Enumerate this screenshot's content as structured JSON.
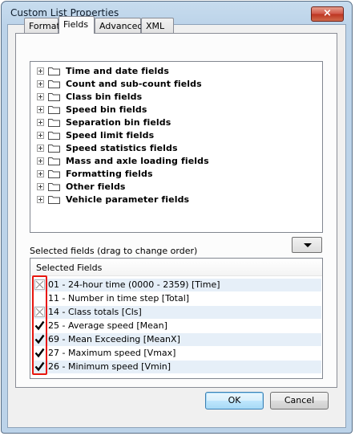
{
  "window": {
    "title": "Custom List Properties",
    "close_glyph": "×"
  },
  "tabs": [
    {
      "label": "Format",
      "active": false
    },
    {
      "label": "Fields",
      "active": true
    },
    {
      "label": "Advanced",
      "active": false
    },
    {
      "label": "XML",
      "active": false
    }
  ],
  "tree": {
    "items": [
      {
        "label": "Time and date fields"
      },
      {
        "label": "Count and sub-count fields"
      },
      {
        "label": "Class bin fields"
      },
      {
        "label": "Speed bin fields"
      },
      {
        "label": "Separation bin fields"
      },
      {
        "label": "Speed limit fields"
      },
      {
        "label": "Speed statistics fields"
      },
      {
        "label": "Mass and axle loading fields"
      },
      {
        "label": "Formatting fields"
      },
      {
        "label": "Other fields"
      },
      {
        "label": "Vehicle parameter fields"
      }
    ]
  },
  "selected": {
    "label": "Selected fields (drag to change order)",
    "header": "Selected Fields",
    "rows": [
      {
        "text": "01 - 24-hour time (0000 - 2359) [Time]",
        "state": "indeterminate"
      },
      {
        "text": "11 - Number in time step [Total]",
        "state": "unchecked"
      },
      {
        "text": "14 - Class totals [Cls]",
        "state": "indeterminate"
      },
      {
        "text": "25 - Average speed [Mean]",
        "state": "checked"
      },
      {
        "text": "69 - Mean Exceeding [MeanX]",
        "state": "checked"
      },
      {
        "text": "27 - Maximum speed [Vmax]",
        "state": "checked"
      },
      {
        "text": "26 - Minimum speed [Vmin]",
        "state": "checked"
      }
    ]
  },
  "buttons": {
    "ok": "OK",
    "cancel": "Cancel"
  },
  "colors": {
    "highlight": "#e8170e",
    "folder": "#4a4a4a",
    "stripe": "#e6eff8",
    "default_button_border": "#3c7fb1"
  }
}
